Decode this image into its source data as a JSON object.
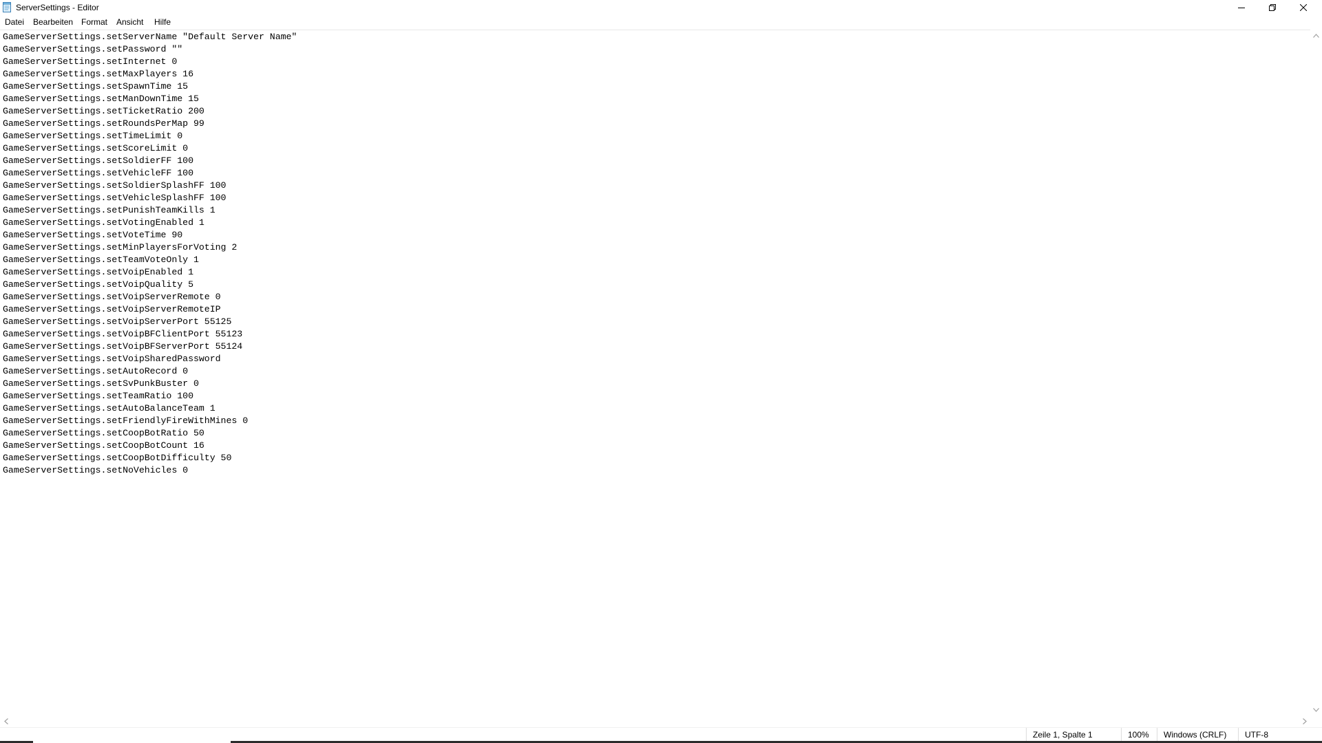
{
  "window": {
    "title": "ServerSettings - Editor",
    "controls": {
      "minimize": "minimize-icon",
      "maximize": "restore-icon",
      "close": "close-icon"
    }
  },
  "menu": {
    "items": [
      "Datei",
      "Bearbeiten",
      "Format",
      "Ansicht",
      "Hilfe"
    ]
  },
  "editor": {
    "lines": [
      "GameServerSettings.setServerName \"Default Server Name\"",
      "GameServerSettings.setPassword \"\"",
      "GameServerSettings.setInternet 0",
      "GameServerSettings.setMaxPlayers 16",
      "GameServerSettings.setSpawnTime 15",
      "GameServerSettings.setManDownTime 15",
      "GameServerSettings.setTicketRatio 200",
      "GameServerSettings.setRoundsPerMap 99",
      "GameServerSettings.setTimeLimit 0",
      "GameServerSettings.setScoreLimit 0",
      "GameServerSettings.setSoldierFF 100",
      "GameServerSettings.setVehicleFF 100",
      "GameServerSettings.setSoldierSplashFF 100",
      "GameServerSettings.setVehicleSplashFF 100",
      "GameServerSettings.setPunishTeamKills 1",
      "GameServerSettings.setVotingEnabled 1",
      "GameServerSettings.setVoteTime 90",
      "GameServerSettings.setMinPlayersForVoting 2",
      "GameServerSettings.setTeamVoteOnly 1",
      "GameServerSettings.setVoipEnabled 1",
      "GameServerSettings.setVoipQuality 5",
      "GameServerSettings.setVoipServerRemote 0",
      "GameServerSettings.setVoipServerRemoteIP",
      "GameServerSettings.setVoipServerPort 55125",
      "GameServerSettings.setVoipBFClientPort 55123",
      "GameServerSettings.setVoipBFServerPort 55124",
      "GameServerSettings.setVoipSharedPassword",
      "GameServerSettings.setAutoRecord 0",
      "GameServerSettings.setSvPunkBuster 0",
      "GameServerSettings.setTeamRatio 100",
      "GameServerSettings.setAutoBalanceTeam 1",
      "GameServerSettings.setFriendlyFireWithMines 0",
      "GameServerSettings.setCoopBotRatio 50",
      "GameServerSettings.setCoopBotCount 16",
      "GameServerSettings.setCoopBotDifficulty 50",
      "GameServerSettings.setNoVehicles 0"
    ]
  },
  "statusbar": {
    "position": "Zeile 1, Spalte 1",
    "zoom": "100%",
    "line_ending": "Windows (CRLF)",
    "encoding": "UTF-8"
  },
  "colors": {
    "background": "#ffffff",
    "text": "#000000",
    "separator": "#dcdcdc"
  }
}
